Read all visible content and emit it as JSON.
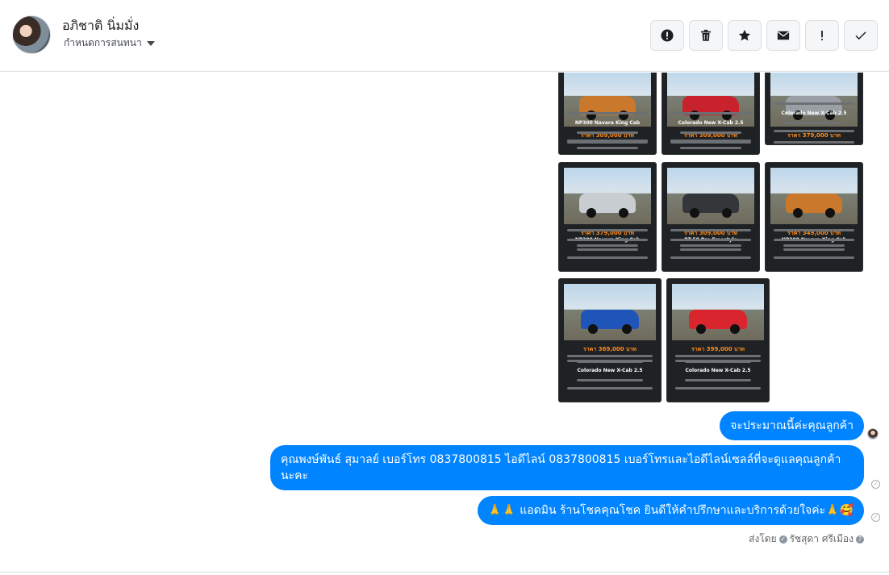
{
  "contact": {
    "name": "อภิชาติ นิ่มมั่ง",
    "assign_label": "กำหนดการสนทนา"
  },
  "toolbar": [
    {
      "name": "report-spam-button",
      "icon": "alert-circle-icon"
    },
    {
      "name": "delete-button",
      "icon": "trash-icon"
    },
    {
      "name": "star-button",
      "icon": "star-icon"
    },
    {
      "name": "mark-unread-button",
      "icon": "envelope-icon"
    },
    {
      "name": "follow-up-button",
      "icon": "exclamation-icon"
    },
    {
      "name": "mark-done-button",
      "icon": "check-icon"
    }
  ],
  "listings": [
    {
      "price": "ราคา 309,000 บาท",
      "model": "NP300 Navara King Cab",
      "car_color": "#c9782c"
    },
    {
      "price": "ราคา 309,000 บาท",
      "model": "Colorado New X-Cab 2.5",
      "car_color": "#c8232c"
    },
    {
      "price": "ราคา 379,000 บาท",
      "model": "Colorado New X-Cab 2.5",
      "car_color": "#9a9fa5"
    },
    {
      "price": "ราคา 379,000 บาท",
      "model": "NP300 Navara King Cab",
      "car_color": "#c8cdd2"
    },
    {
      "price": "ราคา 309,000 บาท",
      "model": "BT-50 Pro Freestyle",
      "car_color": "#34373a"
    },
    {
      "price": "ราคา 349,000 บาท",
      "model": "NP300 Navara King Cab",
      "car_color": "#c9782c"
    },
    {
      "price": "ราคา 369,000 บาท",
      "model": "Colorado New X-Cab 2.5",
      "car_color": "#1f54b8"
    },
    {
      "price": "ราคา 399,000 บาท",
      "model": "Colorado New X-Cab 2.5",
      "car_color": "#d9262e"
    }
  ],
  "messages": {
    "m1": "จะประมาณนี้ค่ะคุณลูกค้า",
    "m2": "คุณพงษ์พันธ์ สุมาลย์      เบอร์โทร 0837800815  ไอดีไลน์ 0837800815   เบอร์โทรและไอดีไลน์เซลล์ที่จะดูแลคุณลูกค้านะคะ",
    "m3": "🙏🙏 แอดมิน ร้านโชคคุณโชค ยินดีให้คำปรึกษาและบริการด้วยใจค่ะ🙏🥰"
  },
  "sent_by": {
    "prefix": "ส่งโดย",
    "agent": "รัชสุดา ศรีเมือง"
  },
  "colors": {
    "bubble": "#0084ff",
    "price": "#ff8a1c"
  }
}
